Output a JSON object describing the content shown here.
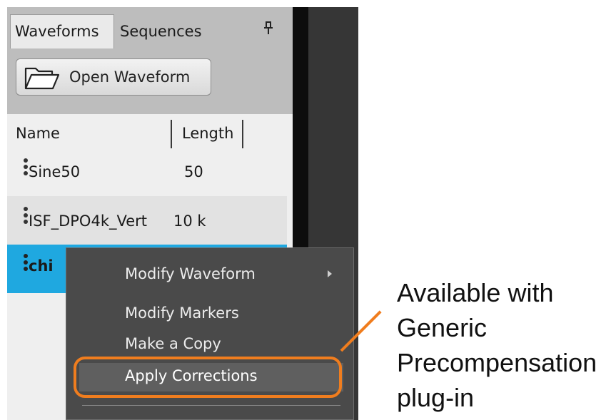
{
  "panel": {
    "tabs": [
      {
        "label": "Waveforms",
        "active": true
      },
      {
        "label": "Sequences",
        "active": false
      }
    ],
    "pin_icon": "pin-icon",
    "open_button": {
      "label": "Open Waveform",
      "icon": "folder-icon"
    },
    "columns": {
      "name": "Name",
      "length": "Length"
    },
    "rows": [
      {
        "name": "Sine50",
        "length": "50",
        "state": "normal"
      },
      {
        "name": "ISF_DPO4k_Vert",
        "length": "10 k",
        "state": "alternate"
      },
      {
        "name": "chi",
        "length": "",
        "state": "selected"
      }
    ]
  },
  "context_menu": {
    "items": [
      {
        "label": "Modify Waveform",
        "has_submenu": true
      },
      {
        "label": "Modify Markers"
      },
      {
        "label": "Make a Copy"
      },
      {
        "label": "Apply Corrections",
        "highlighted": true
      }
    ]
  },
  "callout": {
    "lines": [
      "Available with",
      "Generic",
      "Precompensation",
      "plug-in"
    ],
    "color": "#f07d1e"
  },
  "colors": {
    "selection": "#1fa8e0",
    "accent": "#f07d1e",
    "menu_bg": "#4a4a4a"
  }
}
